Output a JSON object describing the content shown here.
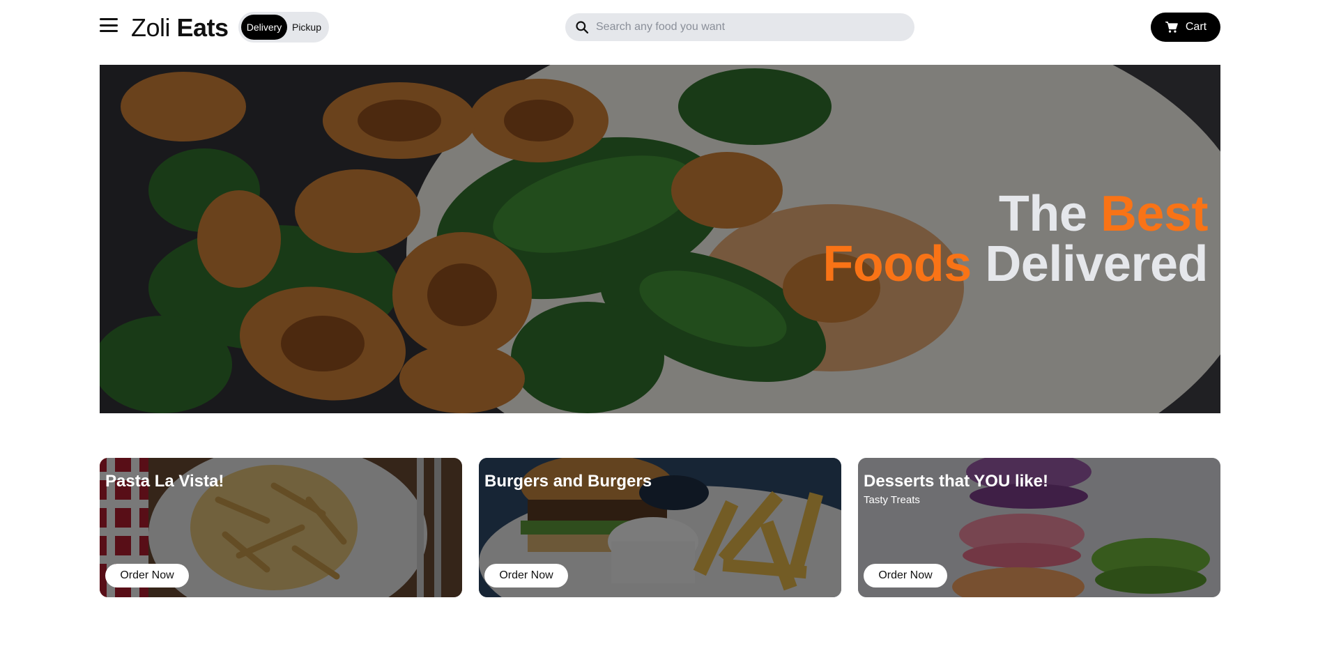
{
  "header": {
    "brand_light": "Zoli",
    "brand_bold": "Eats",
    "mode_options": [
      "Delivery",
      "Pickup"
    ],
    "active_mode": "Delivery",
    "search_placeholder": "Search any food you want",
    "cart_label": "Cart"
  },
  "hero": {
    "line1_plain": "The",
    "line1_accent": "Best",
    "line2_accent": "Foods",
    "line2_plain": "Delivered",
    "accent_color": "#f97316"
  },
  "cards": [
    {
      "title": "Pasta La Vista!",
      "subtitle": "",
      "button": "Order Now"
    },
    {
      "title": "Burgers and Burgers",
      "subtitle": "",
      "button": "Order Now"
    },
    {
      "title": "Desserts that YOU like!",
      "subtitle": "Tasty Treats",
      "button": "Order Now"
    }
  ],
  "colors": {
    "primary": "#000000",
    "accent": "#f97316",
    "muted_bg": "#e5e7eb"
  },
  "icons": [
    "menu-icon",
    "search-icon",
    "cart-icon"
  ]
}
